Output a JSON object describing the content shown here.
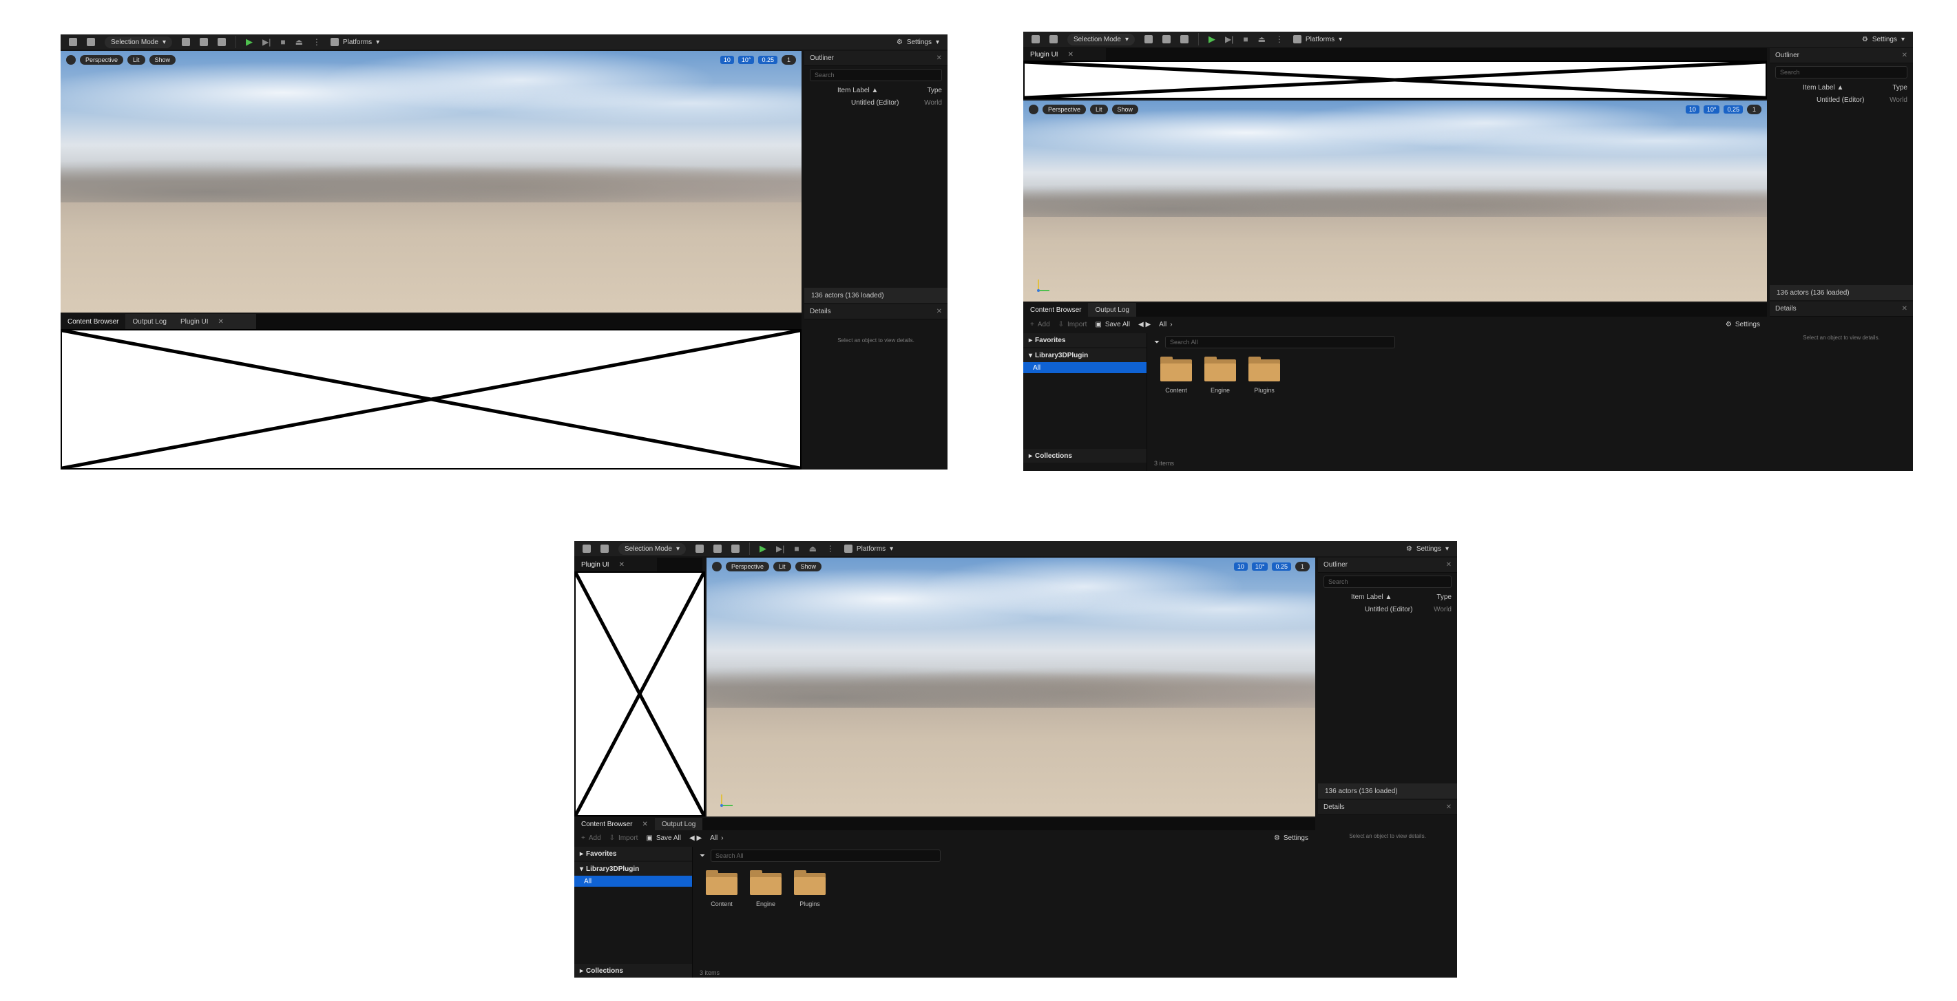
{
  "toolbar": {
    "selection_mode": "Selection Mode",
    "platforms": "Platforms",
    "settings": "Settings"
  },
  "viewport": {
    "perspective": "Perspective",
    "lit": "Lit",
    "show": "Show",
    "grid_snap": "10",
    "rotation_snap": "10°",
    "scale_snap": "0.25",
    "camera_speed": "1"
  },
  "outliner": {
    "title": "Outliner",
    "search_placeholder": "Search",
    "col_label": "Item Label ▲",
    "col_type": "Type",
    "row_label": "Untitled (Editor)",
    "row_type": "World",
    "status": "136 actors (136 loaded)"
  },
  "details": {
    "title": "Details",
    "empty": "Select an object to view details."
  },
  "bottom_tabs": {
    "content_browser": "Content Browser",
    "output_log": "Output Log",
    "plugin_ui": "Plugin UI"
  },
  "content_browser": {
    "add": "Add",
    "import": "Import",
    "save_all": "Save All",
    "path": "All",
    "settings": "Settings",
    "search_placeholder": "Search All",
    "favorites": "Favorites",
    "library": "Library3DPlugin",
    "all": "All",
    "collections": "Collections",
    "folders": [
      "Content",
      "Engine",
      "Plugins"
    ],
    "item_count": "3 items"
  },
  "colors": {
    "accent": "#0f62d3",
    "play": "#4fc04f",
    "folder": "#d5a35e"
  }
}
